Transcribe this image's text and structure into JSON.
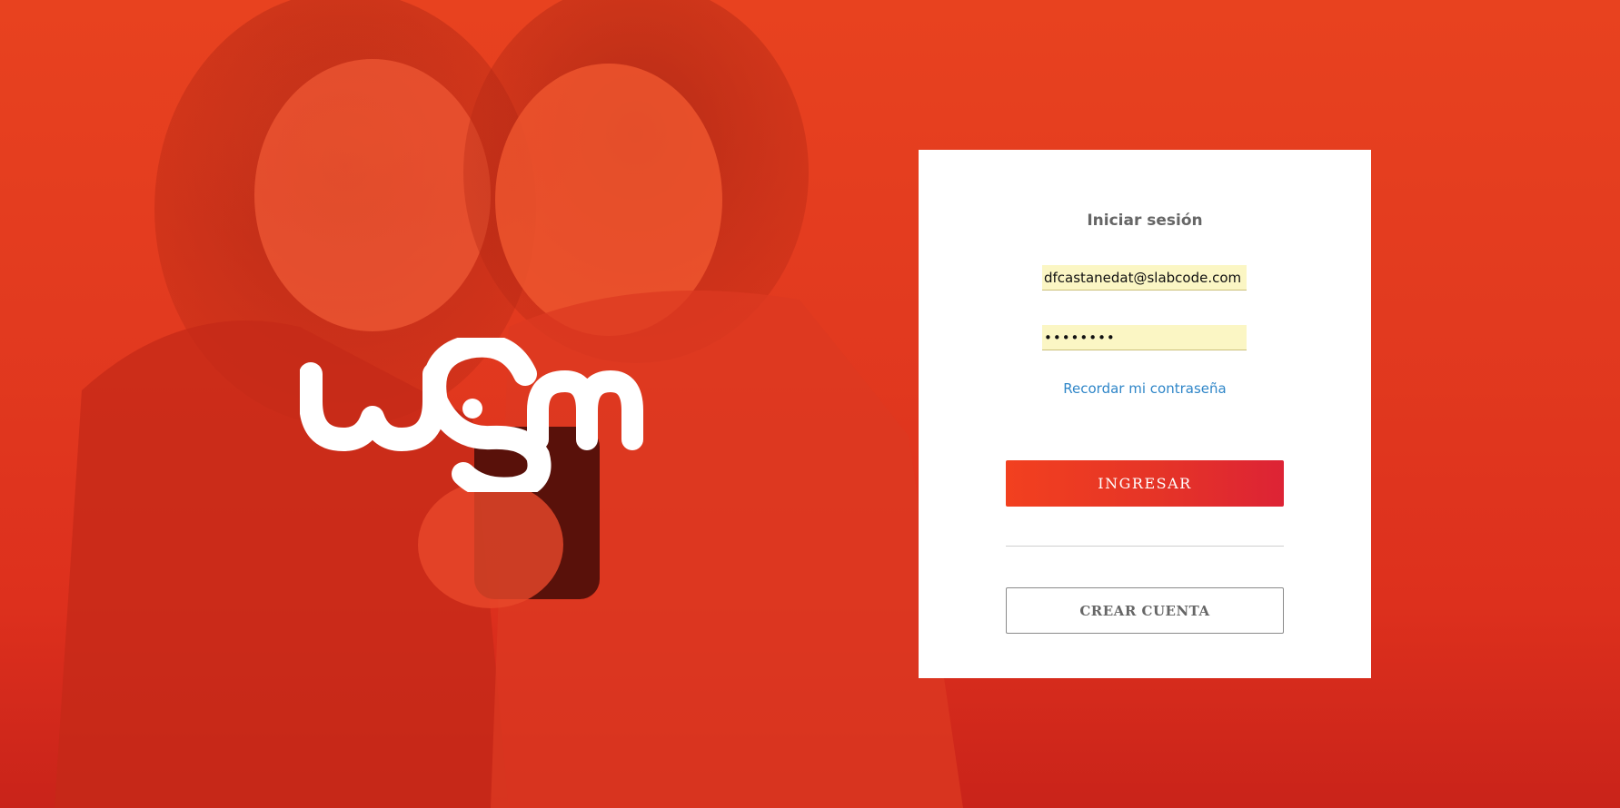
{
  "brand": {
    "logo_text": "wsm",
    "accent_color": "#e23a1f"
  },
  "login": {
    "title": "Iniciar sesión",
    "email_value": "dfcastanedat@slabcode.com",
    "password_value": "••••••••",
    "forgot_label": "Recordar mi contraseña",
    "submit_label": "INGRESAR",
    "create_label": "CREAR CUENTA"
  }
}
